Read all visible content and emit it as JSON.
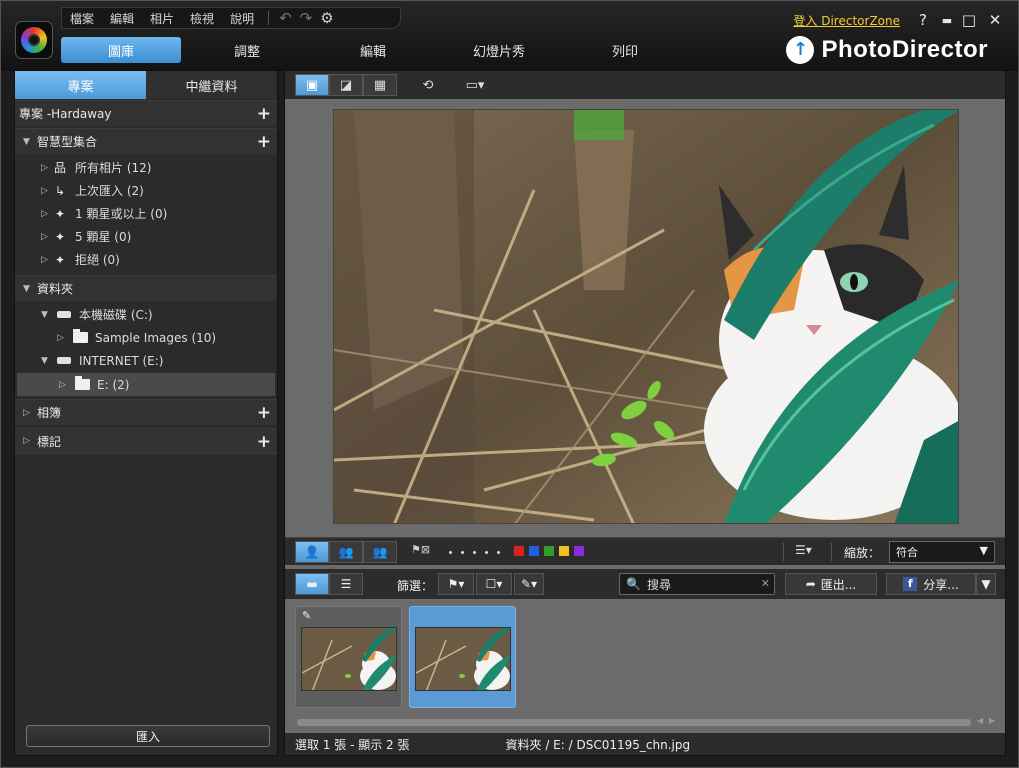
{
  "menu": [
    "檔案",
    "編輯",
    "相片",
    "檢視",
    "說明"
  ],
  "header": {
    "signin": "登入 DirectorZone",
    "help": "?",
    "minimize": "▬",
    "maximize": "□",
    "close": "✕"
  },
  "modes": [
    {
      "label": "圖庫",
      "active": true
    },
    {
      "label": "調整",
      "active": false
    },
    {
      "label": "編輯",
      "active": false
    },
    {
      "label": "幻燈片秀",
      "active": false
    },
    {
      "label": "列印",
      "active": false
    }
  ],
  "brand": {
    "name": "PhotoDirector"
  },
  "left": {
    "tabs": [
      "專案",
      "中繼資料"
    ],
    "project": "專案 -Hardaway",
    "smart_collections": {
      "label": "智慧型集合",
      "items": [
        "所有相片 (12)",
        "上次匯入 (2)",
        "1 顆星或以上 (0)",
        "5 顆星 (0)",
        "拒絕 (0)"
      ]
    },
    "folders": {
      "label": "資料夾",
      "drive_c": "本機磁碟 (C:)",
      "sample": "Sample Images (10)",
      "drive_e": "INTERNET (E:)",
      "e_folder": "E: (2)"
    },
    "albums": "相簿",
    "tags": "標記",
    "import_label": "匯入"
  },
  "midbar": {
    "zoom_label": "縮放：",
    "zoom_value": "符合",
    "colors": [
      "#e02020",
      "#1f5fe0",
      "#2e9e2e",
      "#f0c020",
      "#8a2be2"
    ]
  },
  "filterbar": {
    "filter_label": "篩選：",
    "search_placeholder": "搜尋",
    "export_label": "匯出...",
    "share_label": "分享..."
  },
  "status": {
    "selection": "選取 1 張 - 顯示 2 張",
    "path": "資料夾 / E: / DSC01195_chn.jpg"
  }
}
